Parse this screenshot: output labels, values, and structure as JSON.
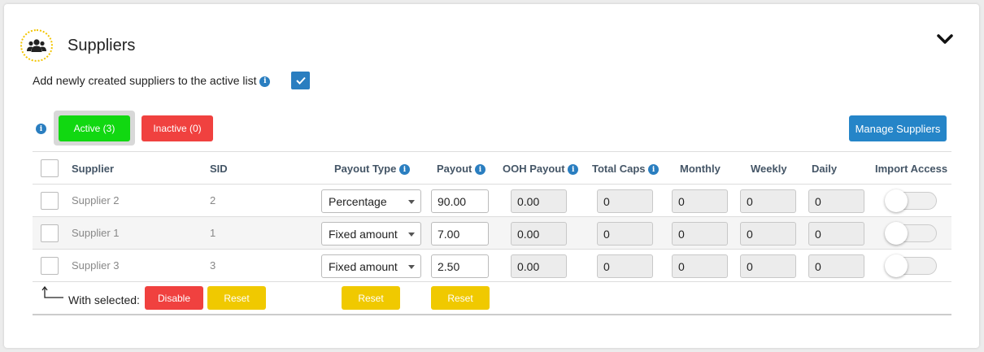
{
  "header": {
    "title": "Suppliers",
    "icon": "users-icon",
    "collapse_icon": "chevron-down-icon"
  },
  "option": {
    "label": "Add newly created suppliers to the active list",
    "checked": true
  },
  "tabs": {
    "active_label": "Active (3)",
    "inactive_label": "Inactive (0)"
  },
  "manage_button": "Manage Suppliers",
  "columns": {
    "supplier": "Supplier",
    "sid": "SID",
    "payout_type": "Payout Type",
    "payout": "Payout",
    "ooh_payout": "OOH Payout",
    "total_caps": "Total Caps",
    "monthly": "Monthly",
    "weekly": "Weekly",
    "daily": "Daily",
    "import_access": "Import Access"
  },
  "rows": [
    {
      "name": "Supplier 2",
      "sid": "2",
      "payout_type": "Percentage",
      "payout": "90.00",
      "ooh_payout": "0.00",
      "total_caps": "0",
      "monthly": "0",
      "weekly": "0",
      "daily": "0",
      "import_access": false
    },
    {
      "name": "Supplier 1",
      "sid": "1",
      "payout_type": "Fixed amount",
      "payout": "7.00",
      "ooh_payout": "0.00",
      "total_caps": "0",
      "monthly": "0",
      "weekly": "0",
      "daily": "0",
      "import_access": false
    },
    {
      "name": "Supplier 3",
      "sid": "3",
      "payout_type": "Fixed amount",
      "payout": "2.50",
      "ooh_payout": "0.00",
      "total_caps": "0",
      "monthly": "0",
      "weekly": "0",
      "daily": "0",
      "import_access": false
    }
  ],
  "bulk": {
    "label": "With selected:",
    "disable": "Disable",
    "reset": "Reset",
    "reset_payout_type": "Reset",
    "reset_payout": "Reset"
  },
  "colors": {
    "accent": "#2585c8",
    "active": "#11d811",
    "inactive": "#f0413f",
    "reset": "#f0c900"
  }
}
